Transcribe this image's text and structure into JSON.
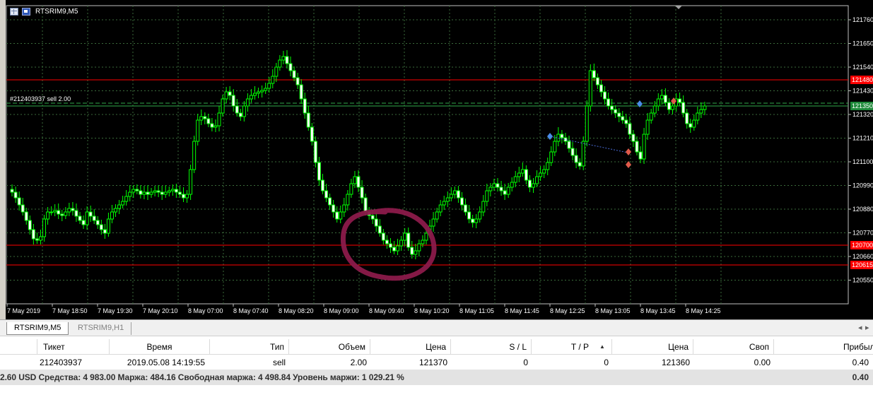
{
  "chart": {
    "title": "RTSRIM9,M5",
    "trade_label": "#212403937 sell 2.00",
    "colors": {
      "background": "#000000",
      "grid": "#3a6a3a",
      "candle": "#00ff00",
      "price_line": "#ff0000",
      "annotation": "#8b1a4a"
    },
    "price_axis": [
      "121760",
      "121650",
      "121540",
      "121430",
      "121320",
      "121210",
      "121100",
      "120990",
      "120880",
      "120770",
      "120660",
      "120550"
    ],
    "price_badges": [
      {
        "label": "121480",
        "color": "#ff0000"
      },
      {
        "label": "121350",
        "color": "#1e8a3a"
      },
      {
        "label": "120700",
        "color": "#ff0000"
      },
      {
        "label": "120615",
        "color": "#ff0000"
      }
    ],
    "time_axis": [
      "7 May 2019",
      "7 May 18:50",
      "7 May 19:30",
      "7 May 20:10",
      "8 May 07:00",
      "8 May 07:40",
      "8 May 08:20",
      "8 May 09:00",
      "8 May 09:40",
      "8 May 10:20",
      "8 May 11:05",
      "8 May 11:45",
      "8 May 12:25",
      "8 May 13:05",
      "8 May 13:45",
      "8 May 14:25"
    ]
  },
  "tabs": [
    {
      "label": "RTSRIM9,M5",
      "active": true
    },
    {
      "label": "RTSRIM9,H1",
      "active": false
    }
  ],
  "table": {
    "headers": {
      "ticket": "Тикет",
      "time": "Время",
      "type": "Тип",
      "volume": "Объем",
      "price": "Цена",
      "sl": "S / L",
      "tp": "T / P",
      "price2": "Цена",
      "swap": "Своп",
      "profit": "Прибыль"
    },
    "trade": {
      "ticket": "212403937",
      "time": "2019.05.08 14:19:55",
      "type": "sell",
      "volume": "2.00",
      "price": "121370",
      "sl": "0",
      "tp": "0",
      "price2": "121360",
      "swap": "0.00",
      "profit": "0.40"
    },
    "summary": {
      "text": "2.60 USD  Средства: 4 983.00  Маржа: 484.16  Свободная маржа: 4 498.84  Уровень маржи: 1 029.21 %",
      "total": "0.40"
    }
  }
}
